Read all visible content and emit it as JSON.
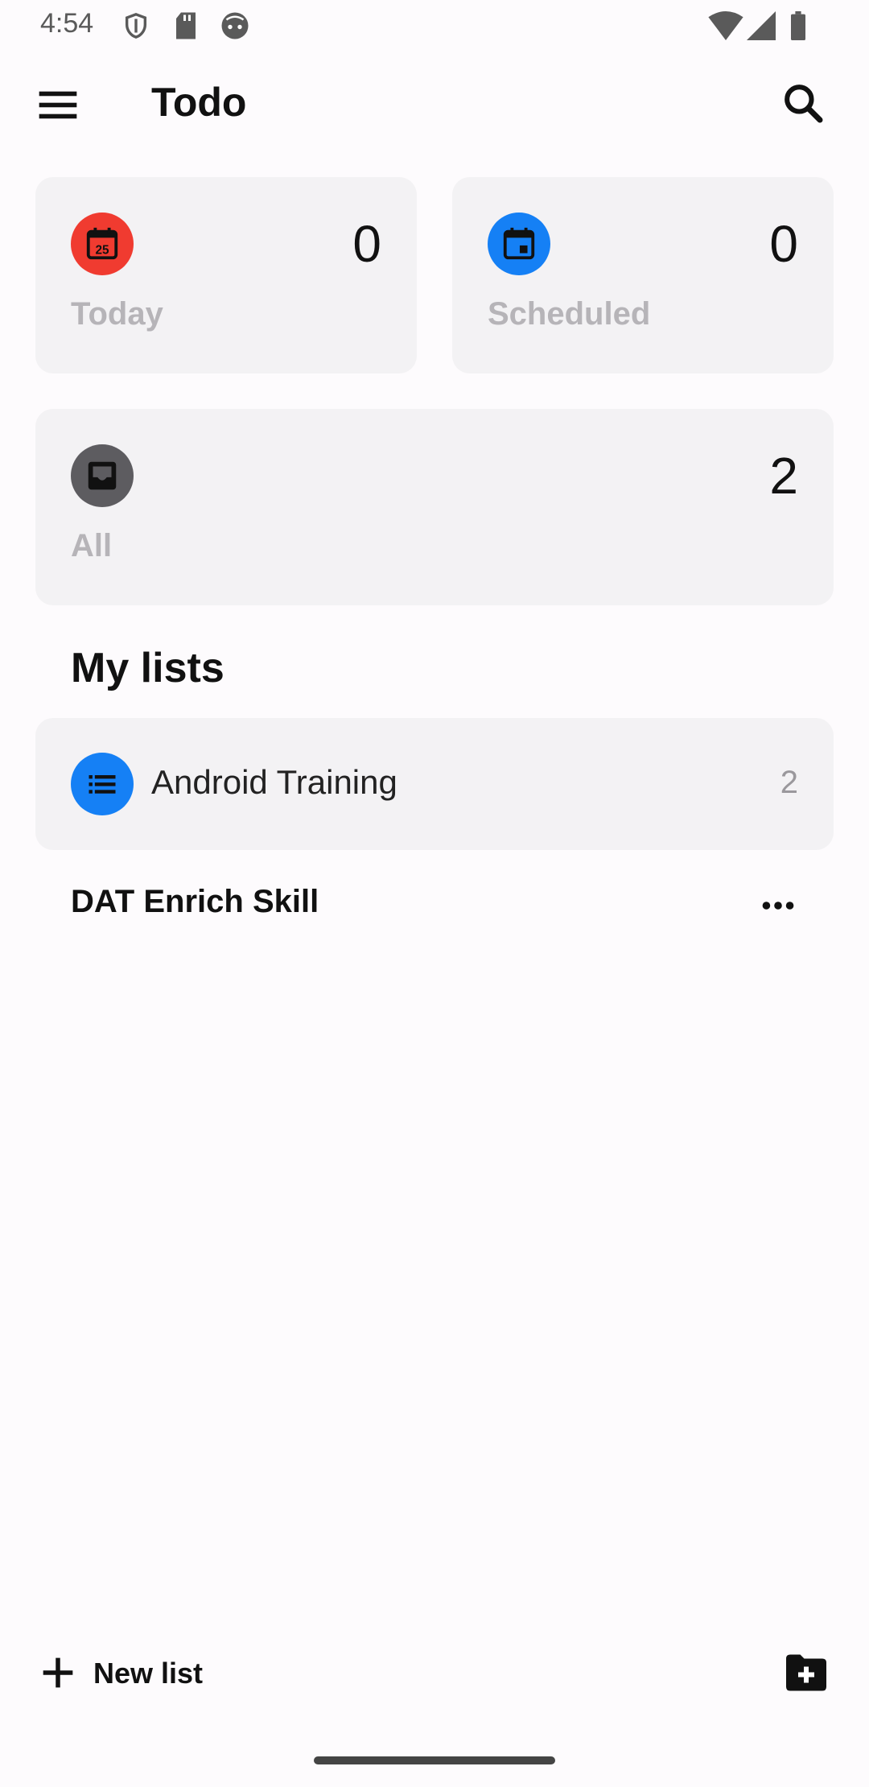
{
  "status_bar": {
    "time": "4:54"
  },
  "app_bar": {
    "title": "Todo",
    "menu_icon": "hamburger-menu-icon",
    "search_icon": "search-icon"
  },
  "smart_lists": {
    "today": {
      "label": "Today",
      "count": "0",
      "icon": "calendar-today-icon",
      "icon_text": "25",
      "color": "#f03b30"
    },
    "scheduled": {
      "label": "Scheduled",
      "count": "0",
      "icon": "calendar-event-icon",
      "color": "#1580f5"
    },
    "all": {
      "label": "All",
      "count": "2",
      "icon": "inbox-icon",
      "color": "#5d5c60"
    }
  },
  "my_lists": {
    "title": "My lists",
    "items": [
      {
        "name": "Android Training",
        "count": "2",
        "icon": "list-icon",
        "color": "#1580f5"
      }
    ],
    "groups": [
      {
        "name": "DAT Enrich Skill",
        "menu_icon": "more-horizontal-icon"
      }
    ]
  },
  "bottom_bar": {
    "new_list_label": "New list",
    "new_list_icon": "plus-icon",
    "new_group_icon": "folder-add-icon"
  }
}
